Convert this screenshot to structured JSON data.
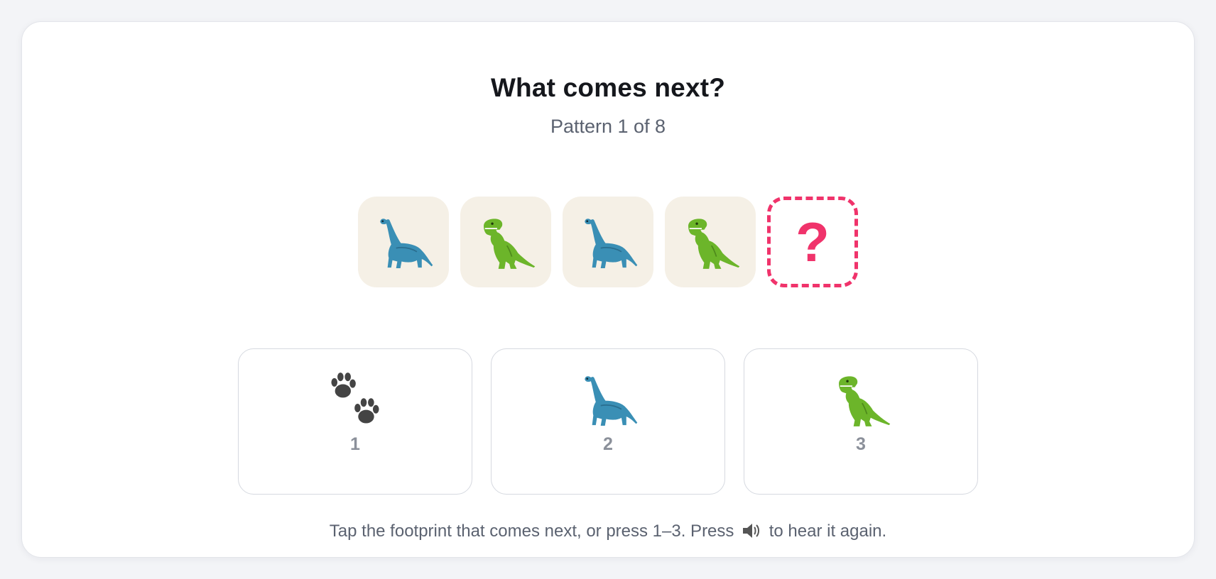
{
  "header": {
    "title_prefix": "What comes ",
    "title_bold": "next?",
    "subtitle": "Pattern 1 of 8"
  },
  "sequence": [
    {
      "kind": "brachiosaurus",
      "icon": "sauropod-icon"
    },
    {
      "kind": "t-rex",
      "icon": "t-rex-icon"
    },
    {
      "kind": "brachiosaurus",
      "icon": "sauropod-icon"
    },
    {
      "kind": "t-rex",
      "icon": "t-rex-icon"
    },
    {
      "kind": "unknown",
      "label": "?"
    }
  ],
  "choices": [
    {
      "number": "1",
      "icon": "paw-prints-icon"
    },
    {
      "number": "2",
      "icon": "sauropod-icon"
    },
    {
      "number": "3",
      "icon": "t-rex-icon"
    }
  ],
  "hint": {
    "before": "Tap the footprint that comes next, or press 1–3. Press",
    "after": "to hear it again.",
    "icon": "speaker-icon"
  },
  "colors": {
    "accent": "#f0336b",
    "tile_bg": "#f5f0e6",
    "sauropod": "#3a8fb5",
    "trex": "#6cb52a"
  }
}
